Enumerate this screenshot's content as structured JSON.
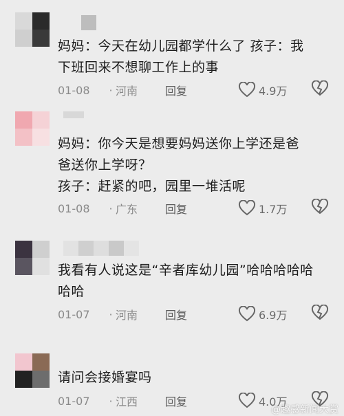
{
  "comments": [
    {
      "text": "妈妈：今天在幼儿园都学什么了 孩子：我下班回来不想聊工作上的事",
      "date": "01-08",
      "location": "河南",
      "reply": "回复",
      "likes": "4.9万"
    },
    {
      "text": "妈妈：你今天是想要妈妈送你上学还是爸爸送你上学呀？孩子：赶紧的吧，园里一堆活呢",
      "line1": "妈妈：你今天是想要妈妈送你上学还是爸",
      "line2": "爸送你上学呀？",
      "line3": "孩子：赶紧的吧，园里一堆活呢",
      "date": "01-08",
      "location": "广东",
      "reply": "回复",
      "likes": "1.7万"
    },
    {
      "line1": "我看有人说这是“辛者库幼儿园”哈哈哈哈哈",
      "line2": "哈哈",
      "date": "01-07",
      "location": "河南",
      "reply": "回复",
      "likes": "6.9万"
    },
    {
      "line1": "请问会接婚宴吗",
      "date": "01-07",
      "location": "江西",
      "reply": "回复",
      "likes": "4.0万"
    }
  ],
  "c1_line1": "妈妈：今天在幼儿园都学什么了 孩子：我",
  "c1_line2": "下班回来不想聊工作上的事",
  "separator": "·",
  "watermark": "@趣感新闻大赏",
  "colors": {
    "background": "#ececec",
    "text": "#1d1d1d",
    "meta": "#8a8a8a"
  }
}
